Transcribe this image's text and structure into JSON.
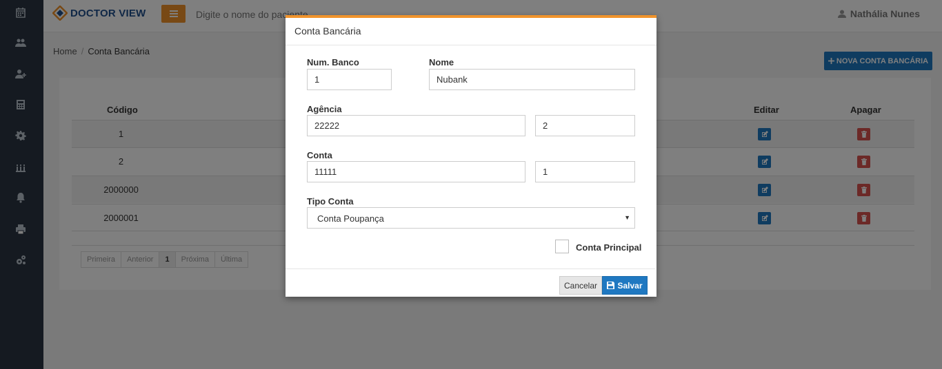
{
  "app": {
    "logo_text": "DOCTOR VIEW",
    "search_placeholder": "Digite o nome do paciente",
    "user_name": "Nathália Nunes"
  },
  "sidebar": {
    "icons": [
      "calendar-icon",
      "users-icon",
      "user-plus-icon",
      "calculator-icon",
      "gear-icon",
      "bank-icon",
      "bell-icon",
      "print-icon",
      "cogs-icon"
    ]
  },
  "breadcrumb": {
    "home": "Home",
    "current": "Conta Bancária"
  },
  "new_button": {
    "label": "NOVA CONTA BANCÁRIA"
  },
  "table": {
    "headers": {
      "code": "Código",
      "edit": "Editar",
      "delete": "Apagar"
    },
    "rows": [
      {
        "code": "1"
      },
      {
        "code": "2"
      },
      {
        "code": "2000000"
      },
      {
        "code": "2000001"
      }
    ]
  },
  "pagination": {
    "first": "Primeira",
    "prev": "Anterior",
    "current": "1",
    "next": "Próxima",
    "last": "Última"
  },
  "modal": {
    "title": "Conta Bancária",
    "bank_number": {
      "label": "Num. Banco",
      "value": "1"
    },
    "name": {
      "label": "Nome",
      "value": "Nubank"
    },
    "agency": {
      "label": "Agência",
      "value": "22222",
      "digit": "2"
    },
    "account": {
      "label": "Conta",
      "value": "11111",
      "digit": "1"
    },
    "account_type": {
      "label": "Tipo Conta",
      "value": "Conta Poupança"
    },
    "main_account": {
      "label": "Conta Principal",
      "checked": false
    },
    "cancel_label": "Cancelar",
    "save_label": "Salvar"
  },
  "colors": {
    "accent": "#f0932b",
    "primary": "#1f78c1",
    "danger": "#d9534f",
    "sidebar": "#2a3542"
  }
}
